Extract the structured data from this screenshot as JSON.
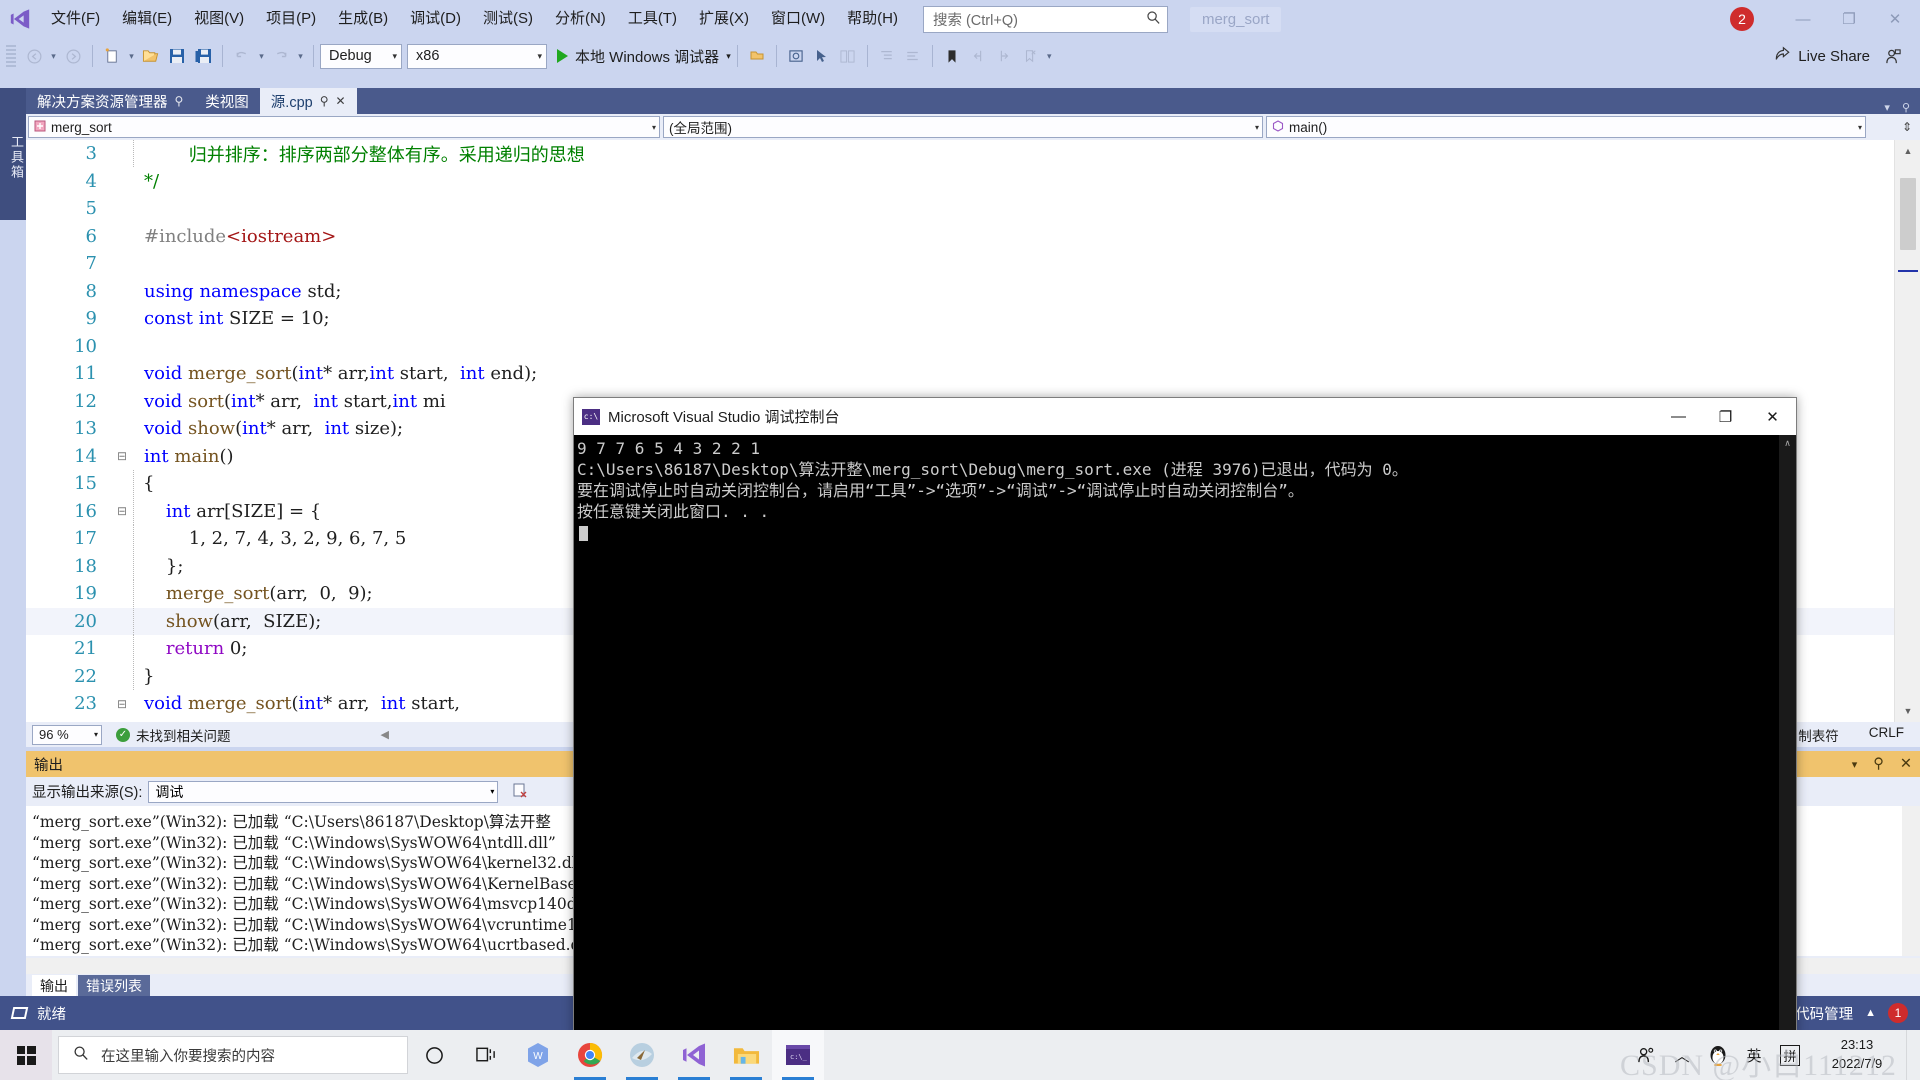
{
  "window": {
    "menu": [
      "文件(F)",
      "编辑(E)",
      "视图(V)",
      "项目(P)",
      "生成(B)",
      "调试(D)",
      "测试(S)",
      "分析(N)",
      "工具(T)",
      "扩展(X)",
      "窗口(W)",
      "帮助(H)"
    ],
    "search_placeholder": "搜索 (Ctrl+Q)",
    "project_name": "merg_sort",
    "notification_count": "2",
    "minimize": "—",
    "maximize": "❐",
    "close": "✕"
  },
  "toolbar": {
    "back": "◀",
    "forward": "▶",
    "new_item": "新建项",
    "open": "打开",
    "save": "保存",
    "save_all": "全部保存",
    "undo": "↶",
    "redo": "↷",
    "config": "Debug",
    "platform": "x86",
    "run_label": "本地 Windows 调试器",
    "live_share": "Live Share"
  },
  "toolbox_label": "工具箱",
  "tabs": [
    {
      "label": "解决方案资源管理器",
      "pin": "⚲",
      "selected": false
    },
    {
      "label": "类视图",
      "pin": "",
      "selected": false
    },
    {
      "label": "源.cpp",
      "pin": "⚲",
      "close": "✕",
      "selected": true
    }
  ],
  "navbar": {
    "project": "merg_sort",
    "scope": "(全局范围)",
    "member": "main()",
    "caret": "▾"
  },
  "editor": {
    "lines": [
      {
        "num": "3",
        "fold": "",
        "indent": true,
        "tokens": [
          {
            "c": "ind",
            "t": "    "
          },
          {
            "c": "cm",
            "t": "    归并排序：排序两部分整体有序。采用递归的思想"
          }
        ]
      },
      {
        "num": "4",
        "fold": "",
        "indent": false,
        "tokens": [
          {
            "c": "cm",
            "t": "*/"
          }
        ]
      },
      {
        "num": "5",
        "fold": "",
        "indent": false,
        "tokens": []
      },
      {
        "num": "6",
        "fold": "",
        "indent": false,
        "tokens": [
          {
            "c": "pp",
            "t": "#include"
          },
          {
            "c": "s",
            "t": "<iostream>"
          }
        ]
      },
      {
        "num": "7",
        "fold": "",
        "indent": false,
        "tokens": []
      },
      {
        "num": "8",
        "fold": "",
        "indent": false,
        "tokens": [
          {
            "c": "k",
            "t": "using"
          },
          {
            "c": "id",
            "t": " "
          },
          {
            "c": "k",
            "t": "namespace"
          },
          {
            "c": "id",
            "t": " std;"
          }
        ]
      },
      {
        "num": "9",
        "fold": "",
        "indent": false,
        "tokens": [
          {
            "c": "k",
            "t": "const"
          },
          {
            "c": "id",
            "t": " "
          },
          {
            "c": "k",
            "t": "int"
          },
          {
            "c": "id",
            "t": " SIZE = 10;"
          }
        ]
      },
      {
        "num": "10",
        "fold": "",
        "indent": false,
        "tokens": []
      },
      {
        "num": "11",
        "fold": "",
        "indent": false,
        "tokens": [
          {
            "c": "k",
            "t": "void"
          },
          {
            "c": "fn",
            "t": " merge_sort"
          },
          {
            "c": "id",
            "t": "("
          },
          {
            "c": "k",
            "t": "int"
          },
          {
            "c": "id",
            "t": "* arr,"
          },
          {
            "c": "k",
            "t": "int"
          },
          {
            "c": "id",
            "t": " start,  "
          },
          {
            "c": "k",
            "t": "int"
          },
          {
            "c": "id",
            "t": " end);"
          }
        ]
      },
      {
        "num": "12",
        "fold": "",
        "indent": false,
        "tokens": [
          {
            "c": "k",
            "t": "void"
          },
          {
            "c": "fn",
            "t": " sort"
          },
          {
            "c": "id",
            "t": "("
          },
          {
            "c": "k",
            "t": "int"
          },
          {
            "c": "id",
            "t": "* arr,  "
          },
          {
            "c": "k",
            "t": "int"
          },
          {
            "c": "id",
            "t": " start,"
          },
          {
            "c": "k",
            "t": "int"
          },
          {
            "c": "id",
            "t": " mi"
          }
        ]
      },
      {
        "num": "13",
        "fold": "",
        "indent": false,
        "tokens": [
          {
            "c": "k",
            "t": "void"
          },
          {
            "c": "fn",
            "t": " show"
          },
          {
            "c": "id",
            "t": "("
          },
          {
            "c": "k",
            "t": "int"
          },
          {
            "c": "id",
            "t": "* arr,  "
          },
          {
            "c": "k",
            "t": "int"
          },
          {
            "c": "id",
            "t": " size);"
          }
        ]
      },
      {
        "num": "14",
        "fold": "⊟",
        "indent": false,
        "tokens": [
          {
            "c": "k",
            "t": "int"
          },
          {
            "c": "fn",
            "t": " main"
          },
          {
            "c": "id",
            "t": "()"
          }
        ]
      },
      {
        "num": "15",
        "fold": "",
        "indent": true,
        "tokens": [
          {
            "c": "id",
            "t": "{"
          }
        ]
      },
      {
        "num": "16",
        "fold": "⊟",
        "indent": true,
        "tokens": [
          {
            "c": "ind",
            "t": "    "
          },
          {
            "c": "k",
            "t": "int"
          },
          {
            "c": "id",
            "t": " arr[SIZE] = {"
          }
        ]
      },
      {
        "num": "17",
        "fold": "",
        "indent": true,
        "tokens": [
          {
            "c": "ind",
            "t": "        "
          },
          {
            "c": "id",
            "t": "1, 2, 7, 4, 3, 2, 9, 6, 7, 5"
          }
        ]
      },
      {
        "num": "18",
        "fold": "",
        "indent": true,
        "tokens": [
          {
            "c": "ind",
            "t": "    "
          },
          {
            "c": "id",
            "t": "};"
          }
        ]
      },
      {
        "num": "19",
        "fold": "",
        "indent": true,
        "tokens": [
          {
            "c": "ind",
            "t": "    "
          },
          {
            "c": "fn",
            "t": "merge_sort"
          },
          {
            "c": "id",
            "t": "(arr,  0,  9);"
          }
        ]
      },
      {
        "num": "20",
        "fold": "",
        "indent": true,
        "highlight": true,
        "tokens": [
          {
            "c": "ind",
            "t": "    "
          },
          {
            "c": "fn",
            "t": "show"
          },
          {
            "c": "id",
            "t": "(arr,  SIZE);"
          }
        ]
      },
      {
        "num": "21",
        "fold": "",
        "indent": true,
        "tokens": [
          {
            "c": "ind",
            "t": "    "
          },
          {
            "c": "kp",
            "t": "return"
          },
          {
            "c": "id",
            "t": " 0;"
          }
        ]
      },
      {
        "num": "22",
        "fold": "",
        "indent": true,
        "tokens": [
          {
            "c": "id",
            "t": "}"
          }
        ]
      },
      {
        "num": "23",
        "fold": "⊟",
        "indent": false,
        "tokens": [
          {
            "c": "k",
            "t": "void"
          },
          {
            "c": "fn",
            "t": " merge_sort"
          },
          {
            "c": "id",
            "t": "("
          },
          {
            "c": "k",
            "t": "int"
          },
          {
            "c": "id",
            "t": "* arr,  "
          },
          {
            "c": "k",
            "t": "int"
          },
          {
            "c": "id",
            "t": " start,"
          }
        ]
      }
    ],
    "status": {
      "zoom": "96 %",
      "issues": "未找到相关问题",
      "indent_mode": "制表符",
      "line_ending": "CRLF"
    }
  },
  "output": {
    "title": "输出",
    "source_label": "显示输出来源(S):",
    "source_value": "调试",
    "lines": [
      "“merg_sort.exe”(Win32): 已加载 “C:\\Users\\86187\\Desktop\\算法开整",
      "“merg_sort.exe”(Win32): 已加载 “C:\\Windows\\SysWOW64\\ntdll.dll”",
      "“merg_sort.exe”(Win32): 已加载 “C:\\Windows\\SysWOW64\\kernel32.dl",
      "“merg_sort.exe”(Win32): 已加载 “C:\\Windows\\SysWOW64\\KernelBase.",
      "“merg_sort.exe”(Win32): 已加载 “C:\\Windows\\SysWOW64\\msvcp140d.d",
      "“merg_sort.exe”(Win32): 已加载 “C:\\Windows\\SysWOW64\\vcruntime14",
      "“merg_sort.exe”(Win32): 已加载 “C:\\Windows\\SysWOW64\\ucrtbased.d"
    ],
    "tabs": [
      {
        "label": "输出",
        "selected": true
      },
      {
        "label": "错误列表",
        "selected": false
      }
    ]
  },
  "statusbar": {
    "ready": "就绪",
    "source_control": "源代码管理",
    "notification_count": "1"
  },
  "console": {
    "title": "Microsoft Visual Studio 调试控制台",
    "icon_label": "c:\\",
    "minimize": "—",
    "maximize": "❐",
    "close": "✕",
    "lines": [
      "9 7 7 6 5 4 3 2 2 1",
      "C:\\Users\\86187\\Desktop\\算法开整\\merg_sort\\Debug\\merg_sort.exe (进程 3976)已退出，代码为 0。",
      "要在调试停止时自动关闭控制台，请启用“工具”->“选项”->“调试”->“调试停止时自动关闭控制台”。",
      "按任意键关闭此窗口. . ."
    ]
  },
  "taskbar": {
    "search_placeholder": "在这里输入你要搜索的内容",
    "cortana": "○",
    "task_view": "task-view",
    "apps": [
      "wps-icon",
      "chrome-icon",
      "internet-explorer-icon",
      "visual-studio-icon",
      "file-explorer-icon",
      "command-prompt-icon"
    ],
    "tray": {
      "people": "people-icon",
      "chevron": "︿",
      "qq": "qq-icon",
      "ime_lang": "英",
      "ime_pinyin": "拼"
    },
    "time": "23:13",
    "date": "2022/7/9"
  },
  "watermark": "CSDN @小白111212"
}
